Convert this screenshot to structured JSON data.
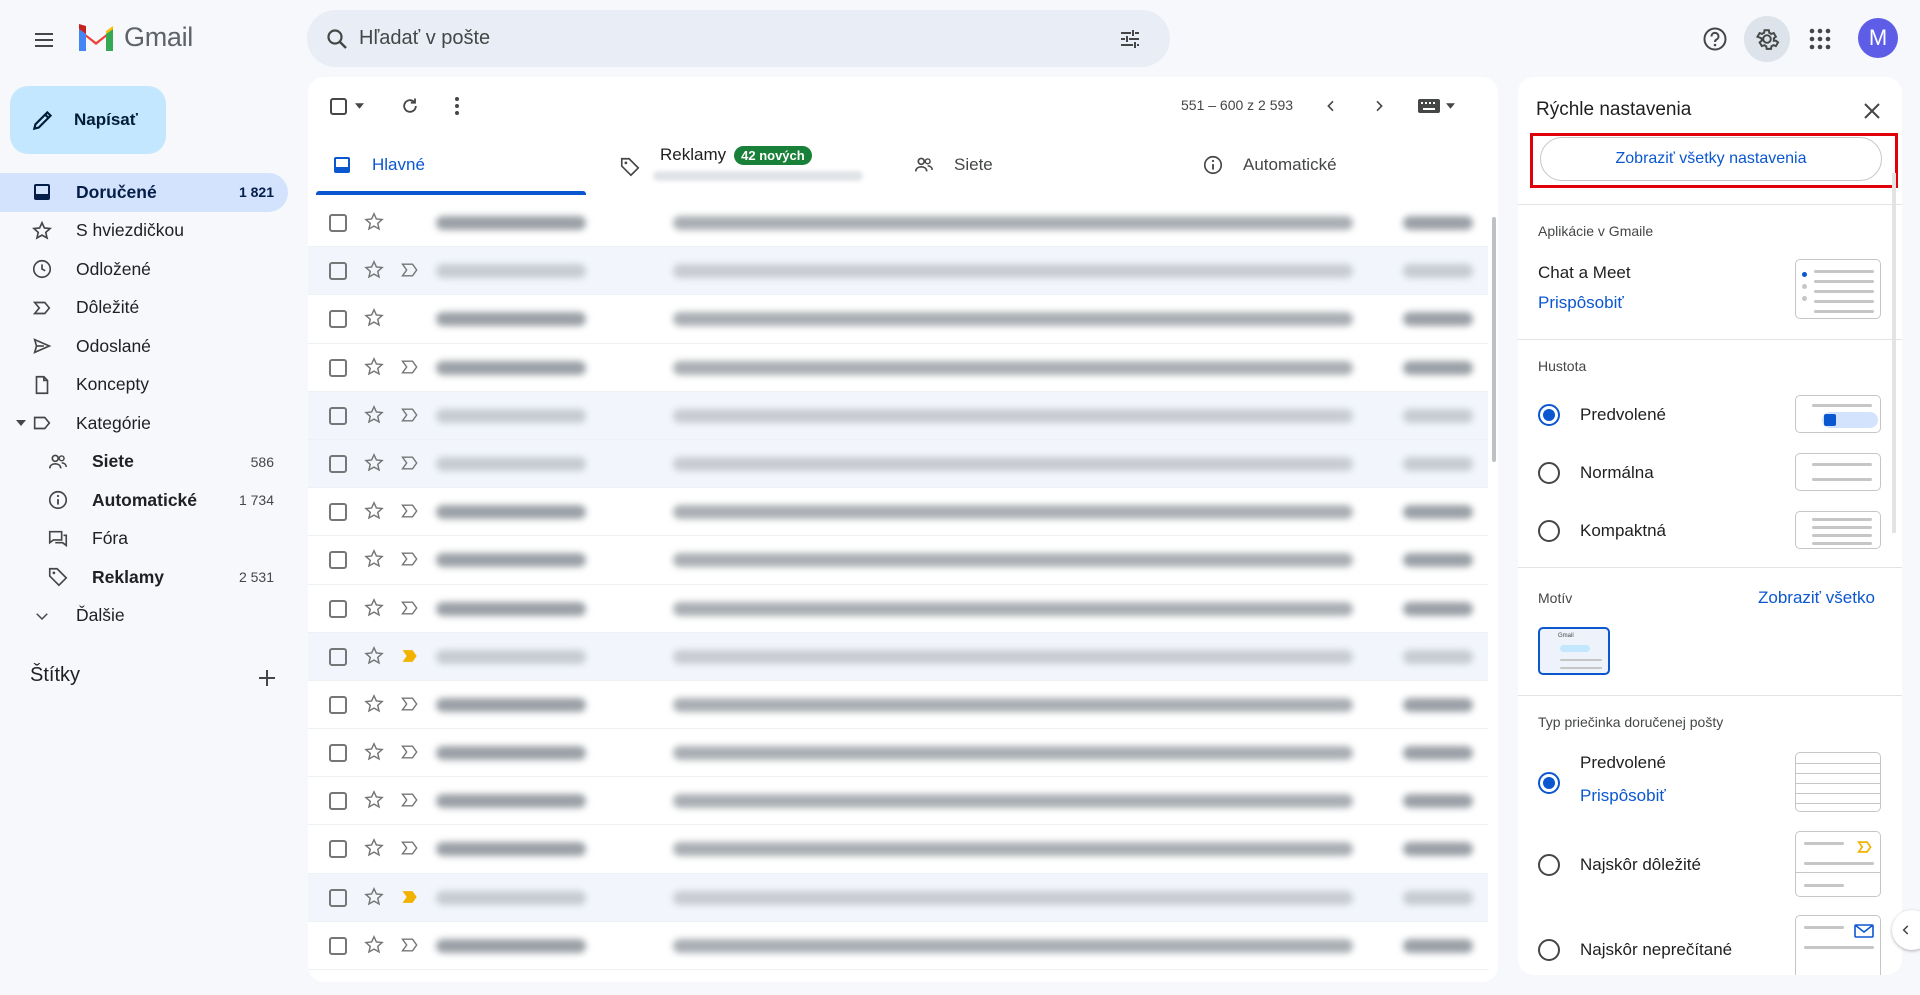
{
  "header": {
    "logo_text": "Gmail",
    "search_placeholder": "Hľadať v pošte",
    "avatar_letter": "M"
  },
  "compose": {
    "label": "Napísať"
  },
  "nav": {
    "inbox": {
      "label": "Doručené",
      "count": "1 821"
    },
    "starred": {
      "label": "S hviezdičkou"
    },
    "snoozed": {
      "label": "Odložené"
    },
    "important": {
      "label": "Dôležité"
    },
    "sent": {
      "label": "Odoslané"
    },
    "drafts": {
      "label": "Koncepty"
    },
    "categories": {
      "label": "Kategórie"
    },
    "social": {
      "label": "Siete",
      "count": "586"
    },
    "updates": {
      "label": "Automatické",
      "count": "1 734"
    },
    "forums": {
      "label": "Fóra"
    },
    "promotions": {
      "label": "Reklamy",
      "count": "2 531"
    },
    "more": {
      "label": "Ďalšie"
    }
  },
  "labels_heading": "Štítky",
  "toolbar": {
    "pager": "551 – 600 z 2 593"
  },
  "tabs": {
    "primary": "Hlavné",
    "promotions": "Reklamy",
    "promotions_badge": "42 nových",
    "social": "Siete",
    "updates": "Automatické"
  },
  "quick_settings": {
    "title": "Rýchle nastavenia",
    "see_all": "Zobraziť všetky nastavenia",
    "apps_heading": "Aplikácie v Gmaile",
    "chat_meet": "Chat a Meet",
    "customize": "Prispôsobiť",
    "density_heading": "Hustota",
    "density_default": "Predvolené",
    "density_normal": "Normálna",
    "density_compact": "Kompaktná",
    "theme_heading": "Motív",
    "theme_view_all": "Zobraziť všetko",
    "theme_thumb_text": "Gmail",
    "inbox_type_heading": "Typ priečinka doručenej pošty",
    "inbox_default": "Predvolené",
    "inbox_customize": "Prispôsobiť",
    "inbox_important_first": "Najskôr dôležité",
    "inbox_unread_first": "Najskôr neprečítané"
  },
  "colors": {
    "accent": "#0b57d0",
    "highlight": "#e0000a",
    "badge": "#188038",
    "important_marker": "#f2b200"
  }
}
